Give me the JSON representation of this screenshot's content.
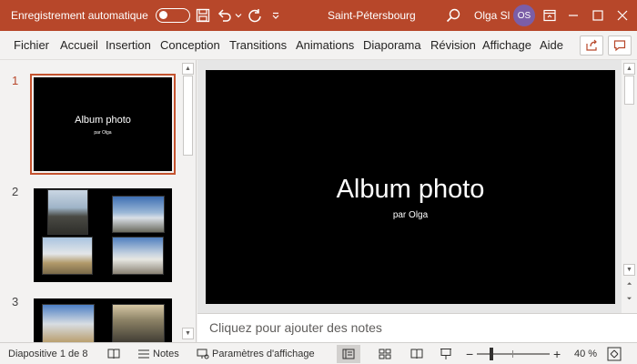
{
  "titlebar": {
    "autosave_label": "Enregistrement automatique",
    "document_title": "Saint-Pétersbourg",
    "user_name": "Olga Sl",
    "user_initials": "OS"
  },
  "ribbon": {
    "tabs": [
      "Fichier",
      "Accueil",
      "Insertion",
      "Conception",
      "Transitions",
      "Animations",
      "Diaporama",
      "Révision",
      "Affichage",
      "Aide"
    ]
  },
  "thumbnails": [
    {
      "number": "1",
      "title": "Album photo",
      "subtitle": "par Olga"
    },
    {
      "number": "2"
    },
    {
      "number": "3"
    }
  ],
  "slide": {
    "title": "Album photo",
    "subtitle": "par Olga"
  },
  "notes_placeholder": "Cliquez pour ajouter des notes",
  "statusbar": {
    "slide_info": "Diapositive 1 de 8",
    "notes_label": "Notes",
    "display_settings_label": "Paramètres d'affichage",
    "zoom_level": "40 %",
    "zoom_minus": "−",
    "zoom_plus": "+"
  },
  "colors": {
    "accent": "#b7472a",
    "selection": "#c4532f"
  }
}
